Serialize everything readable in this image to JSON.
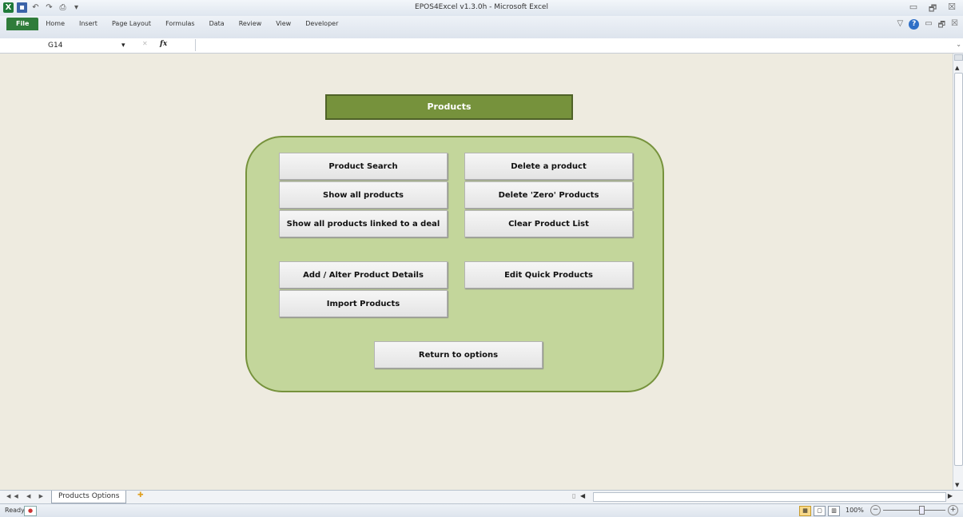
{
  "window": {
    "title": "EPOS4Excel v1.3.0h - Microsoft Excel",
    "logo": "X",
    "controls": [
      "▭",
      "🗗",
      "☒"
    ]
  },
  "quick_access": {
    "save": "▪",
    "undo": "↶",
    "redo": "↷",
    "print": "⎙",
    "customize": "▾"
  },
  "ribbon": {
    "tabs": [
      "File",
      "Home",
      "Insert",
      "Page Layout",
      "Formulas",
      "Data",
      "Review",
      "View",
      "Developer"
    ],
    "right_controls": [
      "▽",
      "?",
      "▭",
      "🗗",
      "☒"
    ]
  },
  "formula_bar": {
    "name_box": "G14",
    "name_arrow": "▾",
    "cancel": "✕",
    "fx": "fx",
    "formula": "",
    "expand": "⌄"
  },
  "dashboard": {
    "header": "Products",
    "buttons": {
      "product_search": "Product Search",
      "delete_product": "Delete a product",
      "show_all": "Show all products",
      "delete_zero": "Delete 'Zero' Products",
      "show_linked": "Show all products linked to a deal",
      "clear_list": "Clear Product List",
      "add_alter": "Add / Alter Product Details",
      "edit_quick": "Edit Quick Products",
      "import": "Import Products",
      "return": "Return to options"
    }
  },
  "sheet_tabs": {
    "nav": "◀◀ ◀ ▶ ▶▶",
    "active": "Products Options",
    "new_sheet": "✚"
  },
  "status_bar": {
    "ready": "Ready",
    "zoom": "100%",
    "zoom_minus": "−",
    "zoom_plus": "+"
  },
  "colors": {
    "header_fill": "#76923c",
    "panel_fill": "#c3d69b",
    "panel_border": "#76923c",
    "file_tab": "#2f7c3a",
    "sheet_bg": "#eeebe0"
  }
}
